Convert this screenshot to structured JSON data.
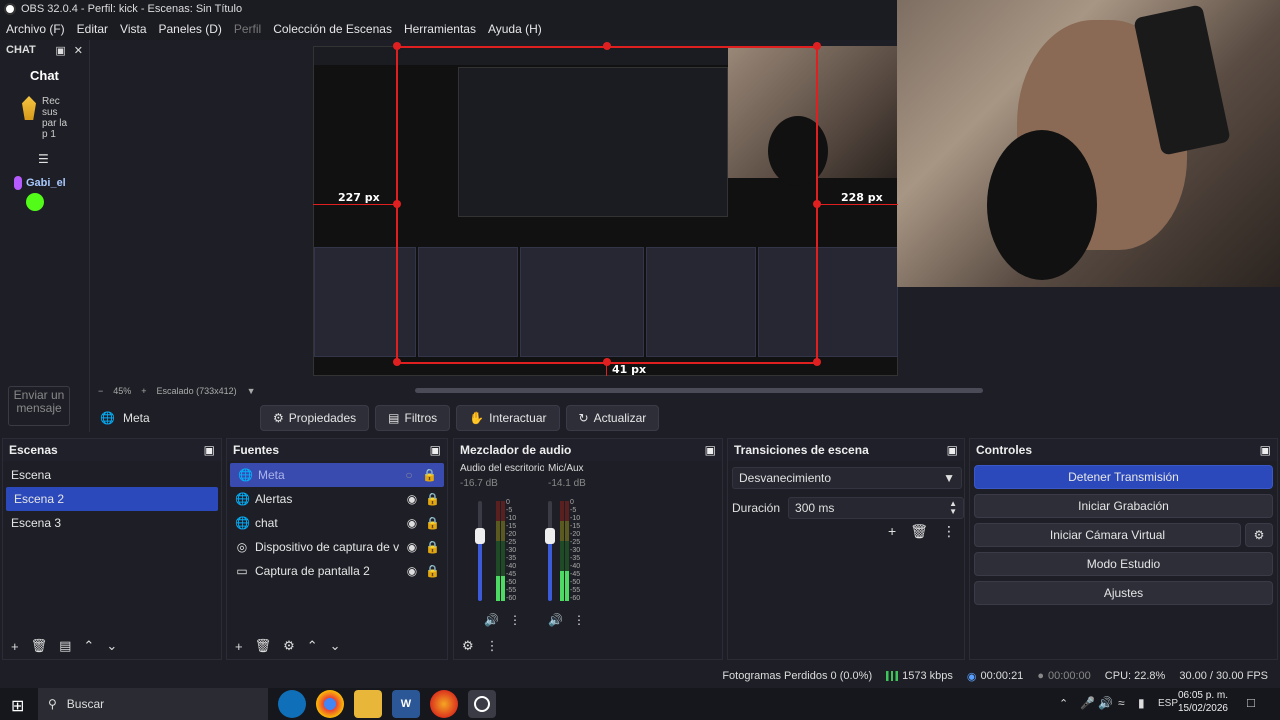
{
  "window": {
    "title": "OBS 32.0.4 - Perfil: kick - Escenas: Sin Título"
  },
  "menu": [
    "Archivo (F)",
    "Editar",
    "Vista",
    "Paneles (D)",
    "Perfil",
    "Colección de Escenas",
    "Herramientas",
    "Ayuda (H)"
  ],
  "chat": {
    "dock_title": "CHAT",
    "title": "Chat",
    "message_text": "Rec sus par la p 1",
    "username": "Gabi_el",
    "input_placeholder": "Enviar un mensaje"
  },
  "preview": {
    "labels": {
      "left": "227 px",
      "right": "228 px",
      "bottom": "41 px"
    },
    "zoom": "45%",
    "scale_text": "Escalado (733x412)"
  },
  "source_toolbar": {
    "selected_source": "Meta",
    "buttons": [
      "Propiedades",
      "Filtros",
      "Interactuar",
      "Actualizar"
    ]
  },
  "scenes": {
    "title": "Escenas",
    "items": [
      "Escena",
      "Escena 2",
      "Escena 3"
    ],
    "selected_index": 1
  },
  "sources": {
    "title": "Fuentes",
    "items": [
      {
        "name": "Meta",
        "icon": "globe-icon",
        "visible": false
      },
      {
        "name": "Alertas",
        "icon": "globe-icon",
        "visible": true
      },
      {
        "name": "chat",
        "icon": "globe-icon",
        "visible": true
      },
      {
        "name": "Dispositivo de captura de video",
        "icon": "camera-icon",
        "visible": true
      },
      {
        "name": "Captura de pantalla 2",
        "icon": "monitor-icon",
        "visible": true
      }
    ]
  },
  "mixer": {
    "title": "Mezclador de audio",
    "channels": [
      {
        "name": "Audio del escritorio",
        "db": "-16.7 dB",
        "fader": 0.35,
        "level": 0.25
      },
      {
        "name": "Mic/Aux",
        "db": "-14.1 dB",
        "fader": 0.35,
        "level": 0.3
      }
    ],
    "ticks": [
      "0",
      "-5",
      "-10",
      "-15",
      "-20",
      "-25",
      "-30",
      "-35",
      "-40",
      "-45",
      "-50",
      "-55",
      "-60"
    ]
  },
  "transitions": {
    "title": "Transiciones de escena",
    "selected": "Desvanecimiento",
    "duration_label": "Duración",
    "duration_value": "300 ms"
  },
  "controls": {
    "title": "Controles",
    "buttons": [
      "Detener Transmisión",
      "Iniciar Grabación",
      "Iniciar Cámara Virtual",
      "Modo Estudio",
      "Ajustes"
    ]
  },
  "status": {
    "dropped_frames": "Fotogramas Perdidos 0 (0.0%)",
    "bitrate": "1573 kbps",
    "stream_time": "00:00:21",
    "rec_time": "00:00:00",
    "cpu": "CPU: 22.8%",
    "fps": "30.00 / 30.00 FPS"
  },
  "taskbar": {
    "search": "Buscar",
    "lang": "ESP",
    "time": "06:05 p. m.",
    "date": "15/02/2026"
  },
  "colors": {
    "accent": "#2b49ba",
    "red_guides": "#e02020"
  }
}
